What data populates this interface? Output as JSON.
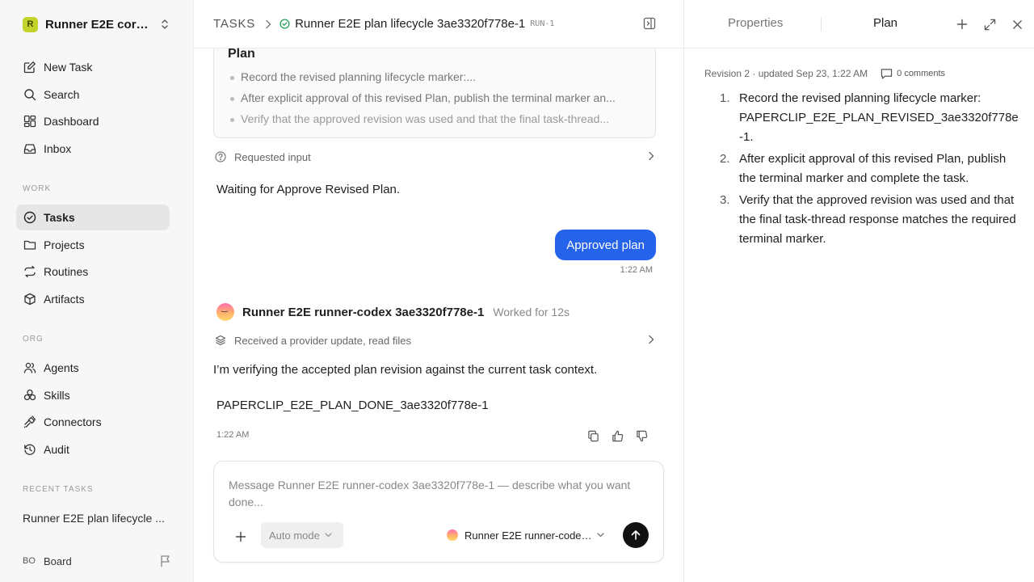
{
  "workspace": {
    "logo_letter": "R",
    "name": "Runner E2E core-..."
  },
  "sidebar": {
    "top_items": [
      {
        "label": "New Task",
        "icon": "edit-icon"
      },
      {
        "label": "Search",
        "icon": "search-icon"
      },
      {
        "label": "Dashboard",
        "icon": "dashboard-icon"
      },
      {
        "label": "Inbox",
        "icon": "inbox-icon"
      }
    ],
    "work_label": "WORK",
    "work_items": [
      {
        "label": "Tasks",
        "icon": "check-circle-icon",
        "active": true
      },
      {
        "label": "Projects",
        "icon": "folder-icon"
      },
      {
        "label": "Routines",
        "icon": "repeat-icon"
      },
      {
        "label": "Artifacts",
        "icon": "package-icon"
      }
    ],
    "org_label": "ORG",
    "org_items": [
      {
        "label": "Agents",
        "icon": "users-icon"
      },
      {
        "label": "Skills",
        "icon": "skills-icon"
      },
      {
        "label": "Connectors",
        "icon": "plug-icon"
      },
      {
        "label": "Audit",
        "icon": "history-icon"
      }
    ],
    "recent_label": "RECENT TASKS",
    "recent_tasks": [
      "Runner E2E plan lifecycle ..."
    ],
    "board": {
      "initials": "BO",
      "label": "Board"
    }
  },
  "header": {
    "section": "TASKS",
    "title": "Runner E2E plan lifecycle 3ae3320f778e-1",
    "run_id": "RUN-1"
  },
  "feed": {
    "plan_card": {
      "title": "Plan",
      "items": [
        "Record the revised planning lifecycle marker:...",
        "After explicit approval of this revised Plan, publish the terminal marker an...",
        "Verify that the approved revision was used and that the final task-thread..."
      ]
    },
    "requested_input_label": "Requested input",
    "waiting_text": "Waiting for Approve Revised Plan.",
    "user_bubble": "Approved plan",
    "user_time": "1:22 AM",
    "agent": {
      "name": "Runner E2E runner-codex 3ae3320f778e-1",
      "worked": "Worked for 12s",
      "activity": "Received a provider update, read files",
      "message": "I’m verifying the accepted plan revision against the current task context.",
      "marker": "PAPERCLIP_E2E_PLAN_DONE_3ae3320f778e-1",
      "time": "1:22 AM"
    }
  },
  "composer": {
    "placeholder": "Message Runner E2E runner-codex 3ae3320f778e-1 — describe what you want done...",
    "value": "",
    "mode": "Auto mode",
    "agent": "Runner E2E runner-codex..."
  },
  "right_panel": {
    "tabs": [
      "Properties",
      "Plan"
    ],
    "active_tab": "Plan",
    "revision": "Revision 2 · updated Sep 23, 1:22 AM",
    "comments": "0 comments",
    "steps": [
      {
        "num": "1.",
        "text": "Record the revised planning lifecycle marker: PAPERCLIP_E2E_PLAN_REVISED_3ae3320f778e-1."
      },
      {
        "num": "2.",
        "text": "After explicit approval of this revised Plan, publish the terminal marker and complete the task."
      },
      {
        "num": "3.",
        "text": "Verify that the approved revision was used and that the final task-thread response matches the required terminal marker."
      }
    ]
  },
  "colors": {
    "accent": "#2563eb",
    "status_done": "#22a05a",
    "workspace_logo": "#c4d32a"
  }
}
